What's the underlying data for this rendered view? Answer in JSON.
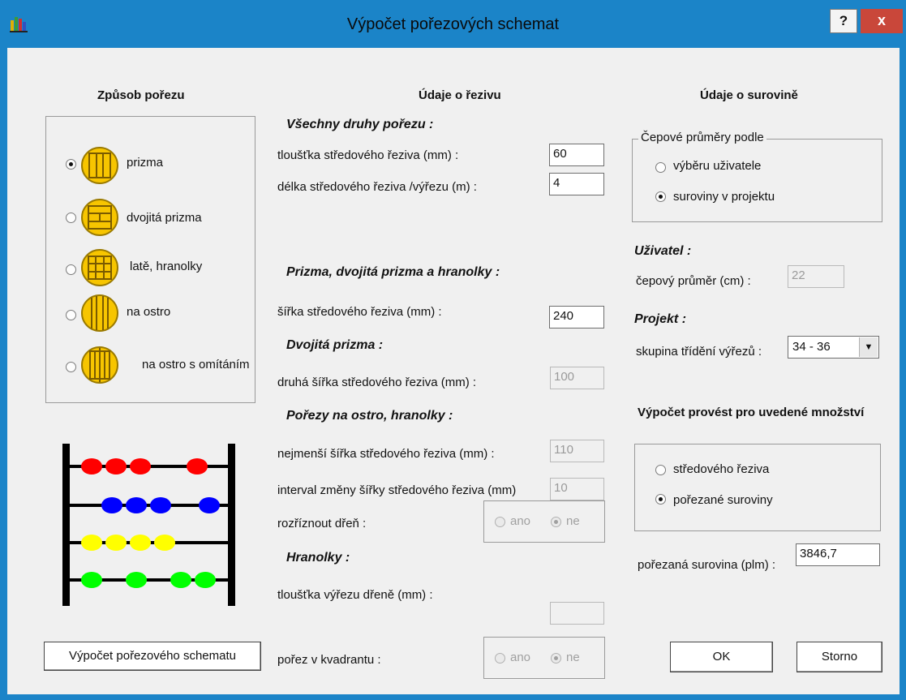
{
  "window": {
    "title": "Výpočet pořezových schemat",
    "help_label": "?",
    "close_label": "x"
  },
  "left": {
    "heading": "Způsob pořezu",
    "options": [
      {
        "label": "prizma",
        "selected": true
      },
      {
        "label": "dvojitá prizma",
        "selected": false
      },
      {
        "label": "latě, hranolky",
        "selected": false
      },
      {
        "label": "na ostro",
        "selected": false
      },
      {
        "label": "na ostro s omítáním",
        "selected": false
      }
    ],
    "calc_button": "Výpočet pořezového schematu",
    "abacus_colors": [
      "#ff0000",
      "#0000ff",
      "#ffff00",
      "#00ff00"
    ]
  },
  "middle": {
    "heading": "Údaje o řezivu",
    "all_types_title": "Všechny druhy pořezu :",
    "thickness_label": "tloušťka středového řeziva (mm) :",
    "thickness_value": "60",
    "length_label": "délka středového řeziva /výřezu  (m) :",
    "length_value": "4",
    "prism_title": "Prizma, dvojitá prizma a hranolky :",
    "width_label": "šířka středového řeziva (mm) :",
    "width_value": "240",
    "double_prism_title": "Dvojitá prizma :",
    "second_width_label": "druhá šířka středového řeziva (mm) :",
    "second_width_value": "100",
    "sharp_title": "Pořezy na ostro, hranolky :",
    "min_width_label": "nejmenší šířka středového řeziva (mm) :",
    "min_width_value": "110",
    "interval_label": "interval změny šířky středového řeziva (mm)",
    "interval_value": "10",
    "split_pith_label": "rozříznout dřeň :",
    "beams_title": "Hranolky :",
    "pith_cut_label": "tloušťka výřezu dřeně (mm) :",
    "pith_cut_value": "",
    "quadrant_label": "pořez v kvadrantu :",
    "yes_label": "ano",
    "no_label": "ne"
  },
  "right": {
    "heading": "Údaje o surovině",
    "diam_group_title": "Čepové průměry podle",
    "diam_options": [
      {
        "label": "výběru uživatele",
        "selected": false
      },
      {
        "label": "suroviny v projektu",
        "selected": true
      }
    ],
    "user_title": "Uživatel :",
    "diameter_label": "čepový průměr (cm) :",
    "diameter_value": "22",
    "project_title": "Projekt :",
    "sort_group_label": "skupina třídění výřezů :",
    "sort_group_value": "34 - 36",
    "calc_for_title": "Výpočet provést pro uvedené množství",
    "calc_options": [
      {
        "label": "středového řeziva",
        "selected": false
      },
      {
        "label": "pořezané suroviny",
        "selected": true
      }
    ],
    "cut_raw_label": "pořezaná surovina (plm) :",
    "cut_raw_value": "3846,7",
    "ok_label": "OK",
    "cancel_label": "Storno"
  }
}
